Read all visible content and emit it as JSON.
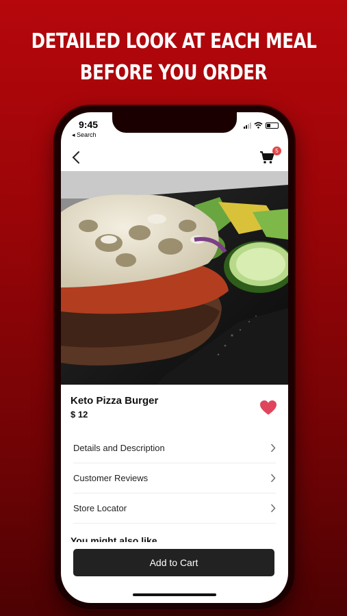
{
  "promo": {
    "line1": "DETAILED LOOK AT EACH MEAL",
    "line2": "BEFORE YOU ORDER"
  },
  "status_bar": {
    "time": "9:45",
    "back_label": "◂ Search"
  },
  "nav": {
    "back_icon": "chevron-left-icon",
    "cart_icon": "cart-icon",
    "cart_count": "5"
  },
  "product": {
    "name": "Keto Pizza Burger",
    "price": "$ 12",
    "favorite": true
  },
  "menu_items": [
    {
      "label": "Details and Description"
    },
    {
      "label": "Customer Reviews"
    },
    {
      "label": "Store Locator"
    }
  ],
  "section": {
    "also_like": "You might also like"
  },
  "actions": {
    "add_to_cart": "Add to Cart"
  },
  "colors": {
    "brand_red": "#b5070c",
    "heart": "#e0455e",
    "button": "#222222"
  }
}
